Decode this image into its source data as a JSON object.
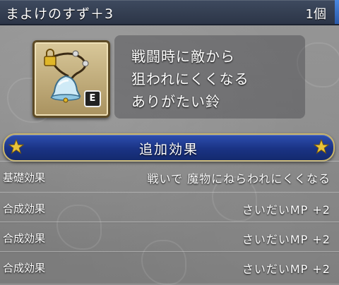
{
  "header": {
    "title": "まよけのすず＋3",
    "count": "1個"
  },
  "item": {
    "icon": "bell-charm-icon",
    "equip_badge": "E",
    "description": [
      "戦闘時に敵から",
      "狙われにくくなる",
      "ありがたい鈴"
    ]
  },
  "effects": {
    "section_label": "追加効果",
    "rows": [
      {
        "key": "基礎効果",
        "value": "戦いで 魔物にねらわれにくくなる"
      },
      {
        "key": "合成効果",
        "value": "さいだいMP +2"
      },
      {
        "key": "合成効果",
        "value": "さいだいMP +2"
      },
      {
        "key": "合成効果",
        "value": "さいだいMP +2"
      }
    ]
  },
  "colors": {
    "header_bg": "#2c3547",
    "section_bg": "#1a3384",
    "frame_bg": "#d9c89a",
    "star": "#e8c33a"
  }
}
